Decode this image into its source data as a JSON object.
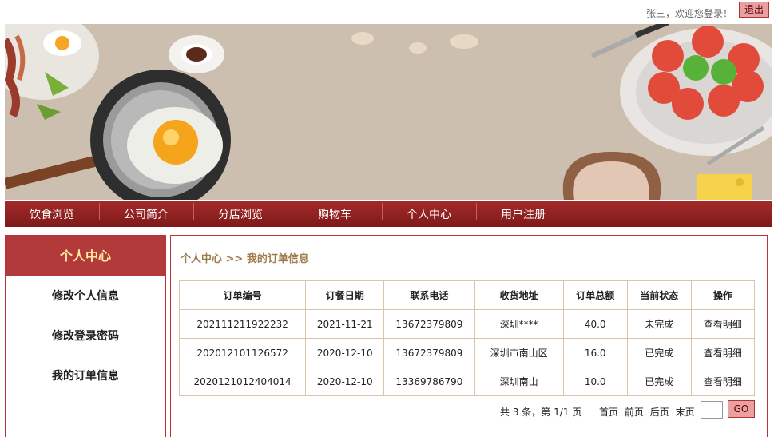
{
  "header": {
    "welcome": "张三，欢迎您登录！",
    "logout_label": "退出"
  },
  "nav": {
    "items": [
      "饮食浏览",
      "公司简介",
      "分店浏览",
      "购物车",
      "个人中心",
      "用户注册"
    ]
  },
  "sidebar": {
    "title": "个人中心",
    "items": [
      "修改个人信息",
      "修改登录密码",
      "我的订单信息"
    ]
  },
  "main": {
    "breadcrumb": "个人中心 >> 我的订单信息",
    "table": {
      "headers": [
        "订单编号",
        "订餐日期",
        "联系电话",
        "收货地址",
        "订单总额",
        "当前状态",
        "操作"
      ],
      "rows": [
        [
          "202111211922232",
          "2021-11-21",
          "13672379809",
          "深圳****",
          "40.0",
          "未完成",
          "查看明细"
        ],
        [
          "202012101126572",
          "2020-12-10",
          "13672379809",
          "深圳市南山区",
          "16.0",
          "已完成",
          "查看明细"
        ],
        [
          "2020121012404014",
          "2020-12-10",
          "13369786790",
          "深圳南山",
          "10.0",
          "已完成",
          "查看明细"
        ]
      ]
    },
    "pager": {
      "summary": "共 3 条，第 1/1 页",
      "first": "首页",
      "prev": "前页",
      "next": "后页",
      "last": "末页",
      "go_label": "GO",
      "page_input": ""
    }
  },
  "colors": {
    "nav_bg": "#8b1e1e",
    "sidebar_head": "#b33a3a",
    "sidebar_head_text": "#ffeaa0",
    "breadcrumb": "#a07c4c",
    "banner_bg": "#ccbfaf"
  },
  "icons": {
    "banner": "breakfast-food-illustration"
  }
}
